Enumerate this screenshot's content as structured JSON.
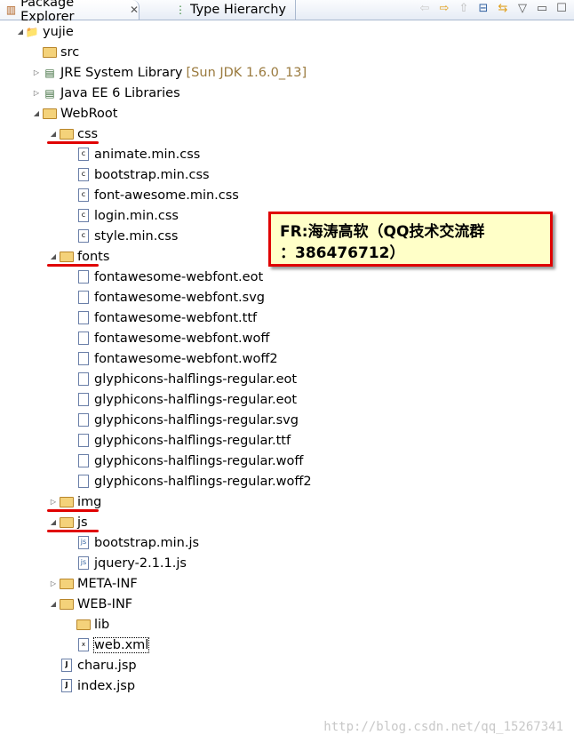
{
  "tabs": [
    {
      "label": "Package Explorer",
      "icon": "package-explorer-icon",
      "active": true
    },
    {
      "label": "Type Hierarchy",
      "icon": "type-hierarchy-icon",
      "active": false
    }
  ],
  "toolbar_icons": [
    "back-icon",
    "forward-icon",
    "up-icon",
    "collapse-all-icon",
    "link-editor-icon",
    "view-menu-icon",
    "minimize-icon",
    "maximize-icon"
  ],
  "tree": [
    {
      "label": "yujie",
      "level": 0,
      "toggle": "expanded",
      "icon": "project"
    },
    {
      "label": "src",
      "level": 1,
      "toggle": "none",
      "icon": "source-folder"
    },
    {
      "label": "JRE System Library",
      "decoration": "[Sun JDK 1.6.0_13]",
      "level": 1,
      "toggle": "collapsed",
      "icon": "library"
    },
    {
      "label": "Java EE 6 Libraries",
      "level": 1,
      "toggle": "collapsed",
      "icon": "library"
    },
    {
      "label": "WebRoot",
      "level": 1,
      "toggle": "expanded",
      "icon": "folder"
    },
    {
      "label": "css",
      "level": 2,
      "toggle": "expanded",
      "icon": "folder",
      "underline": true
    },
    {
      "label": "animate.min.css",
      "level": 3,
      "toggle": "none",
      "icon": "css-file"
    },
    {
      "label": "bootstrap.min.css",
      "level": 3,
      "toggle": "none",
      "icon": "css-file"
    },
    {
      "label": "font-awesome.min.css",
      "level": 3,
      "toggle": "none",
      "icon": "css-file"
    },
    {
      "label": "login.min.css",
      "level": 3,
      "toggle": "none",
      "icon": "css-file"
    },
    {
      "label": "style.min.css",
      "level": 3,
      "toggle": "none",
      "icon": "css-file"
    },
    {
      "label": "fonts",
      "level": 2,
      "toggle": "expanded",
      "icon": "folder",
      "underline": true
    },
    {
      "label": "fontawesome-webfont.eot",
      "level": 3,
      "toggle": "none",
      "icon": "file"
    },
    {
      "label": "fontawesome-webfont.svg",
      "level": 3,
      "toggle": "none",
      "icon": "file"
    },
    {
      "label": "fontawesome-webfont.ttf",
      "level": 3,
      "toggle": "none",
      "icon": "file"
    },
    {
      "label": "fontawesome-webfont.woff",
      "level": 3,
      "toggle": "none",
      "icon": "file"
    },
    {
      "label": "fontawesome-webfont.woff2",
      "level": 3,
      "toggle": "none",
      "icon": "file"
    },
    {
      "label": "glyphicons-halflings-regular.eot",
      "level": 3,
      "toggle": "none",
      "icon": "file"
    },
    {
      "label": "glyphicons-halflings-regular.eot",
      "level": 3,
      "toggle": "none",
      "icon": "file"
    },
    {
      "label": "glyphicons-halflings-regular.svg",
      "level": 3,
      "toggle": "none",
      "icon": "file"
    },
    {
      "label": "glyphicons-halflings-regular.ttf",
      "level": 3,
      "toggle": "none",
      "icon": "file"
    },
    {
      "label": "glyphicons-halflings-regular.woff",
      "level": 3,
      "toggle": "none",
      "icon": "file"
    },
    {
      "label": "glyphicons-halflings-regular.woff2",
      "level": 3,
      "toggle": "none",
      "icon": "file"
    },
    {
      "label": "img",
      "level": 2,
      "toggle": "collapsed",
      "icon": "folder",
      "underline": true
    },
    {
      "label": "js",
      "level": 2,
      "toggle": "expanded",
      "icon": "folder",
      "underline": true
    },
    {
      "label": "bootstrap.min.js",
      "level": 3,
      "toggle": "none",
      "icon": "js-file"
    },
    {
      "label": "jquery-2.1.1.js",
      "level": 3,
      "toggle": "none",
      "icon": "js-file"
    },
    {
      "label": "META-INF",
      "level": 2,
      "toggle": "collapsed",
      "icon": "folder"
    },
    {
      "label": "WEB-INF",
      "level": 2,
      "toggle": "expanded",
      "icon": "folder"
    },
    {
      "label": "lib",
      "level": 3,
      "toggle": "none",
      "icon": "folder"
    },
    {
      "label": "web.xml",
      "level": 3,
      "toggle": "none",
      "icon": "xml-file",
      "selected": true
    },
    {
      "label": "charu.jsp",
      "level": 2,
      "toggle": "none",
      "icon": "jsp-file"
    },
    {
      "label": "index.jsp",
      "level": 2,
      "toggle": "none",
      "icon": "jsp-file"
    }
  ],
  "note": {
    "line1": "FR:海涛高软（QQ技术交流群",
    "line2": "：386476712）"
  },
  "watermark": "http://blog.csdn.net/qq_15267341",
  "colors": {
    "underline": "#e00000",
    "note_bg": "#ffffc8",
    "decoration": "#9a7a3e"
  }
}
